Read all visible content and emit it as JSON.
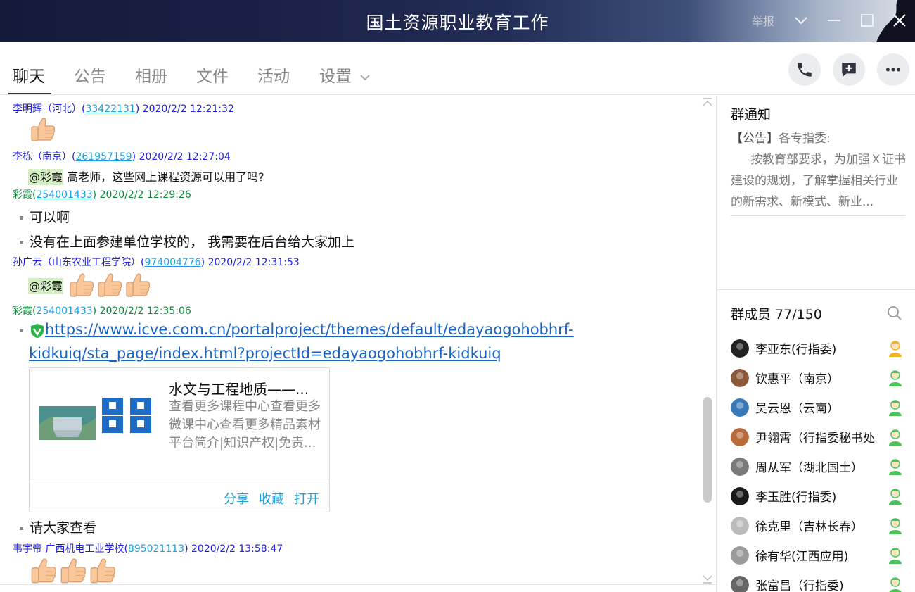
{
  "window": {
    "title": "国土资源职业教育工作",
    "report_label": "举报"
  },
  "tabs": [
    {
      "label": "聊天"
    },
    {
      "label": "公告"
    },
    {
      "label": "相册"
    },
    {
      "label": "文件"
    },
    {
      "label": "活动"
    },
    {
      "label": "设置"
    }
  ],
  "chat": {
    "messages": [
      {
        "sender": "李明辉（河北）",
        "qq": "33422131",
        "time": "2020/2/2 12:21:32"
      },
      {
        "sender": "李栋（南京）",
        "qq": "261957159",
        "time": "2020/2/2 12:27:04",
        "mention": "@彩霞",
        "text": " 高老师，这些网上课程资源可以用了吗?"
      },
      {
        "sender": "彩霞",
        "qq": "254001433",
        "time": "2020/2/2 12:29:26",
        "lines": [
          "可以啊",
          "没有在上面参建单位学校的， 我需要在后台给大家加上"
        ]
      },
      {
        "sender": "孙广云（山东农业工程学院）",
        "qq": "974004776",
        "time": "2020/2/2 12:31:53",
        "mention": "@彩霞"
      },
      {
        "sender": "彩霞",
        "qq": "254001433",
        "time": "2020/2/2 12:35:06",
        "link_line1": "https://www.icve.com.cn/portalproject/themes/default/edayaogohobhrf-",
        "link_line2": "kidkuiq/sta_page/index.html?projectId=edayaogohobhrf-kidkuiq",
        "after": "请大家查看"
      },
      {
        "sender": "韦宇帝 广西机电工业学校",
        "qq": "895021113",
        "time": "2020/2/2 13:58:47"
      }
    ],
    "card": {
      "title": "水文与工程地质——...",
      "description": "查看更多课程中心查看更多微课中心查看更多精品素材平台简介|知识产权|免责...",
      "share_label": "分享",
      "favorite_label": "收藏",
      "open_label": "打开"
    }
  },
  "notice": {
    "title": "群通知",
    "label": "【公告】",
    "head": "各专指委:",
    "body": "按教育部要求，为加强Ｘ证书建设的规划，了解掌握相关行业的新需求、新模式、新业..."
  },
  "members": {
    "title": "群成员 77/150",
    "list": [
      {
        "name": "李亚东(行指委)",
        "role": "owner"
      },
      {
        "name": "钦惠平（南京）",
        "role": "member"
      },
      {
        "name": "吴云恩（云南）",
        "role": "member"
      },
      {
        "name": "尹翎霄（行指委秘书处",
        "role": "member"
      },
      {
        "name": "周从军（湖北国土）",
        "role": "member"
      },
      {
        "name": "李玉胜(行指委)",
        "role": "member"
      },
      {
        "name": "徐克里（吉林长春）",
        "role": "member"
      },
      {
        "name": "徐有华(江西应用)",
        "role": "member"
      },
      {
        "name": "张富昌（行指委)",
        "role": "member"
      }
    ]
  },
  "colors": {
    "sender_blue": "#1e1ee0",
    "sender_green": "#0d8a3a",
    "link_blue": "#1a62c0",
    "accent": "#1ea0d8"
  }
}
